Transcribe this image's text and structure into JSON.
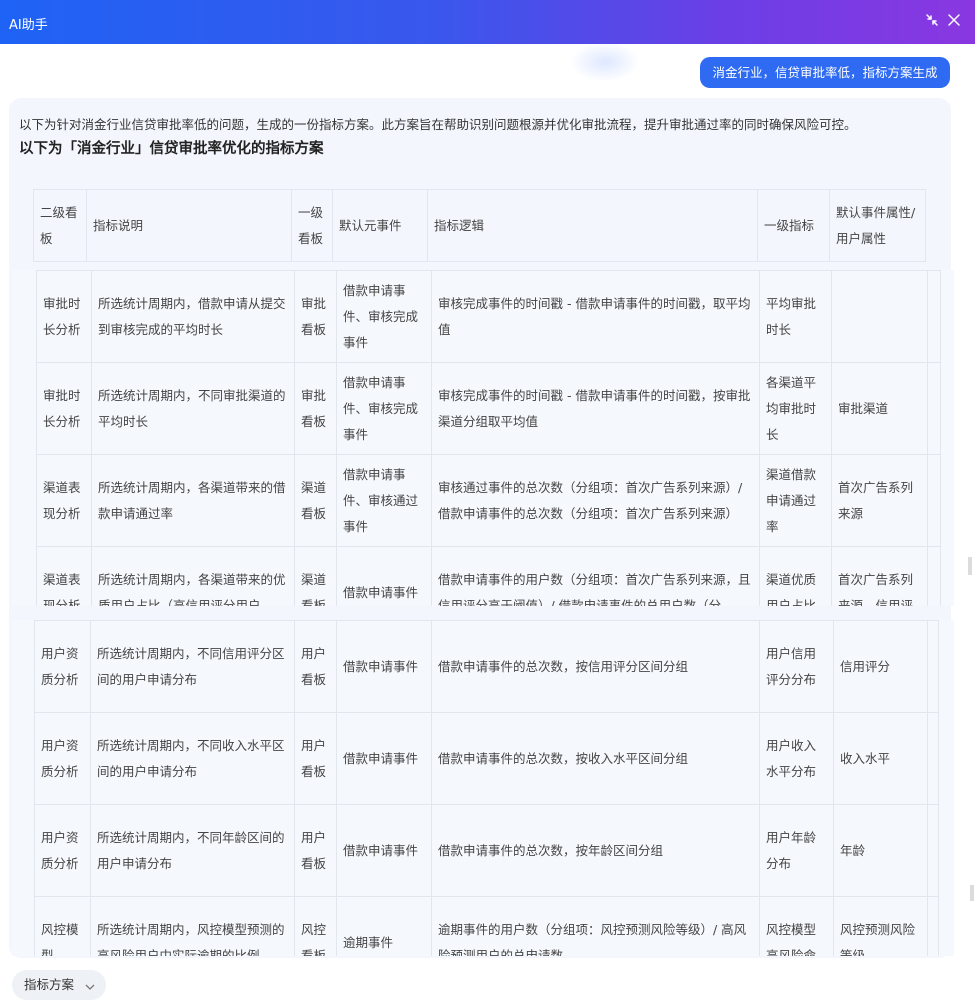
{
  "window": {
    "title": "AI助手",
    "controls": [
      "shrink-icon",
      "close-icon"
    ]
  },
  "user_message": "消金行业，信贷审批率低，指标方案生成",
  "answer": {
    "intro": "以下为针对消金行业信贷审批率低的问题，生成的一份指标方案。此方案旨在帮助识别问题根源并优化审批流程，提升审批通过率的同时确保风险可控。",
    "heading": "以下为「消金行业」信贷审批率优化的指标方案",
    "columns": [
      "二级看板",
      "指标说明",
      "一级看板",
      "默认元事件",
      "指标逻辑",
      "一级指标",
      "默认事件属性/用户属性"
    ],
    "rows_block1": [
      [
        "审批时长分析",
        "所选统计周期内，借款申请从提交到审核完成的平均时长",
        "审批看板",
        "借款申请事件、审核完成事件",
        "审核完成事件的时间戳 - 借款申请事件的时间戳，取平均值",
        "平均审批时长",
        ""
      ],
      [
        "审批时长分析",
        "所选统计周期内，不同审批渠道的平均时长",
        "审批看板",
        "借款申请事件、审核完成事件",
        "审核完成事件的时间戳 - 借款申请事件的时间戳，按审批渠道分组取平均值",
        "各渠道平均审批时长",
        "审批渠道"
      ],
      [
        "渠道表现分析",
        "所选统计周期内，各渠道带来的借款申请通过率",
        "渠道看板",
        "借款申请事件、审核通过事件",
        "审核通过事件的总次数（分组项：首次广告系列来源）/ 借款申请事件的总次数（分组项：首次广告系列来源）",
        "渠道借款申请通过率",
        "首次广告系列来源"
      ],
      [
        "渠道表现分析",
        "所选统计周期内，各渠道带来的优质用户占比（高信用评分用户",
        "渠道看板",
        "借款申请事件",
        "借款申请事件的用户数（分组项：首次广告系列来源，且信用评分高于阈值）/ 借款申请事件的总用户数（分",
        "渠道优质用户占比",
        "首次广告系列来源、信用评"
      ]
    ],
    "rows_block2": [
      [
        "用户资质分析",
        "所选统计周期内，不同信用评分区间的用户申请分布",
        "用户看板",
        "借款申请事件",
        "借款申请事件的总次数，按信用评分区间分组",
        "用户信用评分分布",
        "信用评分"
      ],
      [
        "用户资质分析",
        "所选统计周期内，不同收入水平区间的用户申请分布",
        "用户看板",
        "借款申请事件",
        "借款申请事件的总次数，按收入水平区间分组",
        "用户收入水平分布",
        "收入水平"
      ],
      [
        "用户资质分析",
        "所选统计周期内，不同年龄区间的用户申请分布",
        "用户看板",
        "借款申请事件",
        "借款申请事件的总次数，按年龄区间分组",
        "用户年龄分布",
        "年龄"
      ],
      [
        "风控模型",
        "所选统计周期内，风控模型预测的高风险用户中实际逾期的比例",
        "风控看板",
        "逾期事件",
        "逾期事件的用户数（分组项：风控预测风险等级）/ 高风险预测用户的总申请数",
        "风控模型高风险命",
        "风控预测风险等级"
      ]
    ]
  },
  "footer": {
    "filter_label": "指标方案",
    "filter_icon": "chevron-down-icon"
  }
}
